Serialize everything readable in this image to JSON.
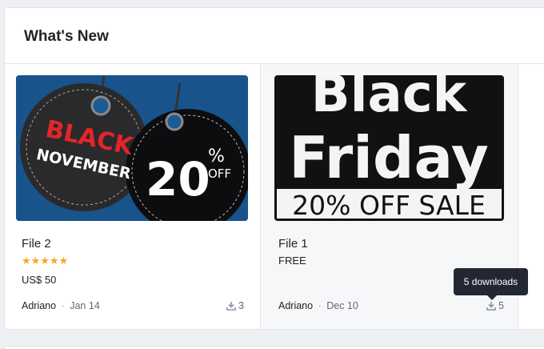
{
  "section": {
    "title": "What's New"
  },
  "files": [
    {
      "name": "File 2",
      "rating_stars": "★★★★★",
      "rating": 5,
      "price": "US$ 50",
      "author": "Adriano",
      "date": "Jan 14",
      "downloads": "3",
      "thumbnail": {
        "tag1_line1": "BLACK",
        "tag1_line2": "NOVEMBER",
        "tag2_big": "20",
        "tag2_pct": "%",
        "tag2_off": "OFF"
      }
    },
    {
      "name": "File 1",
      "price": "FREE",
      "author": "Adriano",
      "date": "Dec 10",
      "downloads": "5",
      "thumbnail": {
        "line1": "Black",
        "line2": "Friday",
        "line3": "20% OFF SALE"
      }
    }
  ],
  "tooltip": {
    "text": "5 downloads"
  },
  "separator": "·",
  "colors": {
    "star": "#f5a623",
    "tooltip_bg": "#232733",
    "thumb1_bg": "#1c5a94"
  }
}
